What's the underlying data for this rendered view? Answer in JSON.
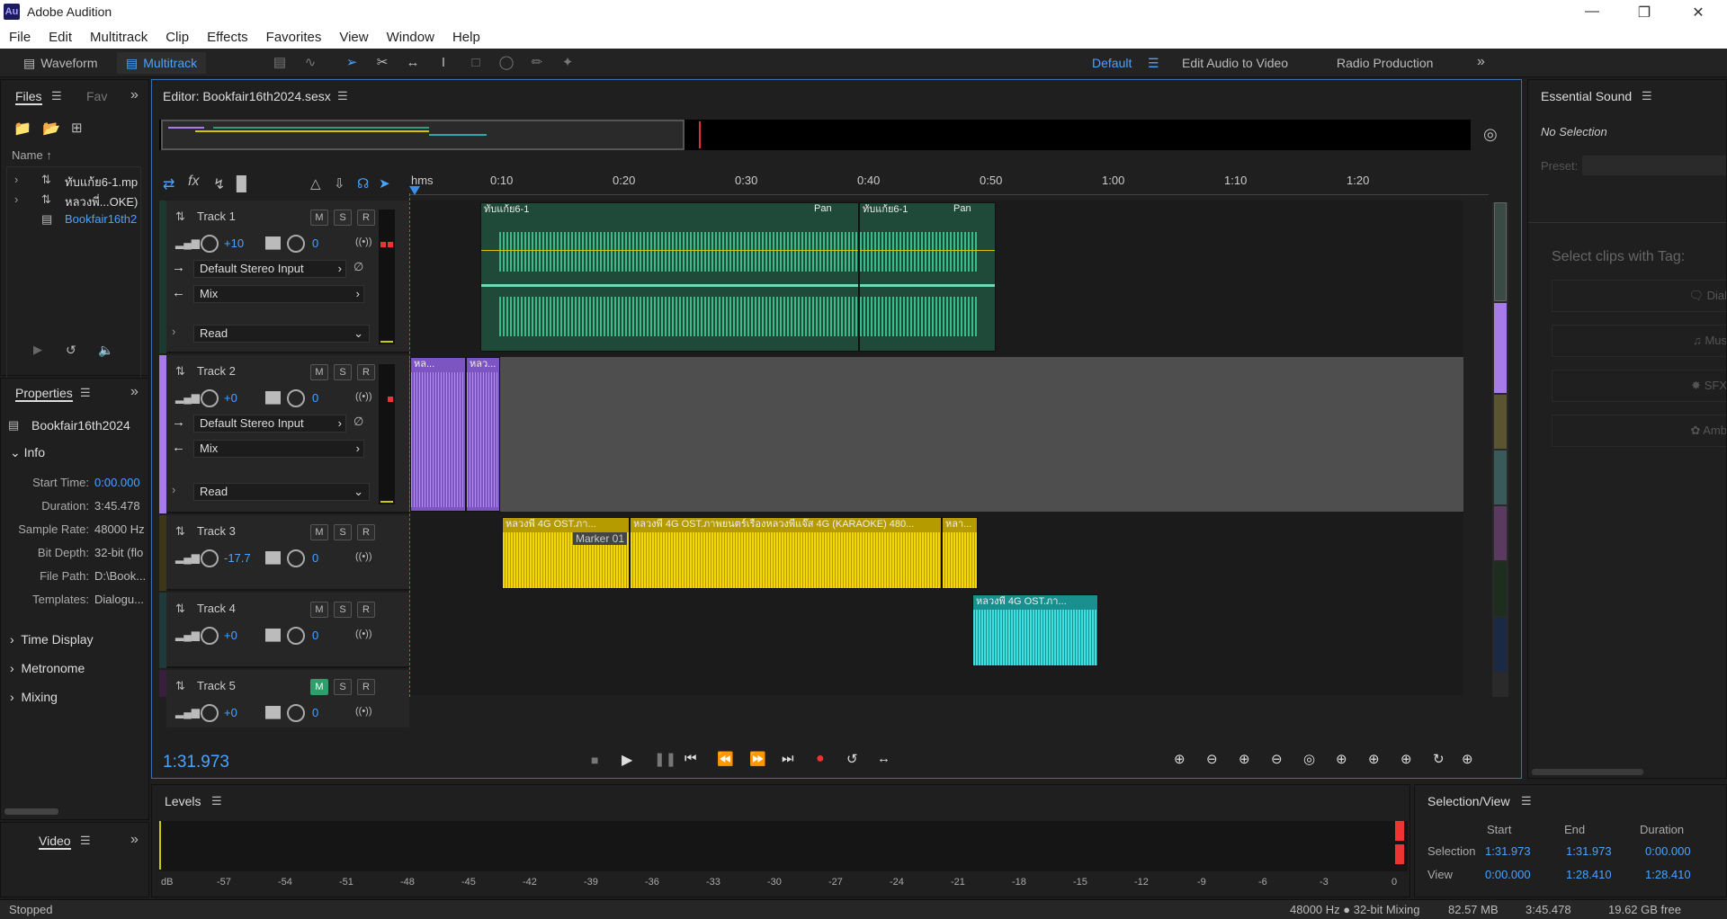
{
  "window": {
    "title": "Adobe Audition",
    "logo_text": "Au"
  },
  "menu": [
    "File",
    "Edit",
    "Multitrack",
    "Clip",
    "Effects",
    "Favorites",
    "View",
    "Window",
    "Help"
  ],
  "toolbar": {
    "waveform_label": "Waveform",
    "multitrack_label": "Multitrack",
    "workspaces": [
      {
        "label": "Default",
        "active": true
      },
      {
        "label": "Edit Audio to Video",
        "active": false
      },
      {
        "label": "Radio Production",
        "active": false
      }
    ]
  },
  "files_panel": {
    "tab_files": "Files",
    "tab_favorites": "Fav",
    "column_name": "Name ↑",
    "items": [
      {
        "name": "ทับแก้ย6-1.mp",
        "type": "audio",
        "selected": false
      },
      {
        "name": "หลวงพี่...OKE)",
        "type": "audio",
        "selected": false
      },
      {
        "name": "Bookfair16th2",
        "type": "session",
        "selected": true
      }
    ]
  },
  "properties_panel": {
    "title": "Properties",
    "session_name": "Bookfair16th2024",
    "info_section": "Info",
    "rows": [
      {
        "key": "Start Time:",
        "value": "0:00.000",
        "highlight": true
      },
      {
        "key": "Duration:",
        "value": "3:45.478",
        "highlight": false
      },
      {
        "key": "Sample Rate:",
        "value": "48000 Hz",
        "highlight": false
      },
      {
        "key": "Bit Depth:",
        "value": "32-bit (flo",
        "highlight": false
      },
      {
        "key": "File Path:",
        "value": "D:\\Book...",
        "highlight": false
      },
      {
        "key": "Templates:",
        "value": "Dialogu...",
        "highlight": false
      }
    ],
    "sections": [
      "Time Display",
      "Metronome",
      "Mixing"
    ]
  },
  "video_panel": {
    "title": "Video"
  },
  "editor": {
    "title": "Editor: Bookfair16th2024.sesx",
    "current_time": "1:31.973",
    "ruler": [
      "hms",
      "0:10",
      "0:20",
      "0:30",
      "0:40",
      "0:50",
      "1:00",
      "1:10",
      "1:20"
    ],
    "tracks": [
      {
        "name": "Track 1",
        "volume": "+10",
        "pan": "0",
        "input": "Default Stereo Input",
        "output": "Mix",
        "automation": "Read",
        "color": "#2e9e7a",
        "mute": false,
        "clips": [
          {
            "title": "ทับแก้ย6-1",
            "pan": "Pan"
          },
          {
            "title": "ทับแก้ย6-1",
            "pan": "Pan"
          }
        ]
      },
      {
        "name": "Track 2",
        "volume": "+0",
        "pan": "0",
        "input": "Default Stereo Input",
        "output": "Mix",
        "automation": "Read",
        "color": "#a87ce8",
        "mute": false,
        "clips": [
          {
            "title": "หล..."
          },
          {
            "title": "หลว..."
          }
        ]
      },
      {
        "name": "Track 3",
        "volume": "-17.7",
        "pan": "0",
        "color": "#7a6e22",
        "mute": false,
        "clips": [
          {
            "title": "หลวงพี่ 4G OST.ภา..."
          },
          {
            "title": "หลวงพี่ 4G OST.ภาพยนตร์เรื่องหลวงพี่แจ๊ส 4G (KARAOKE) 480..."
          },
          {
            "title": "หลา..."
          }
        ],
        "marker": "Marker 01"
      },
      {
        "name": "Track 4",
        "volume": "+0",
        "pan": "0",
        "color": "#2a5e5e",
        "mute": false,
        "clips": [
          {
            "title": "หลวงพี่ 4G OST.ภา..."
          }
        ]
      },
      {
        "name": "Track 5",
        "volume": "+0",
        "pan": "0",
        "color": "#5a2e5e",
        "mute": true,
        "clips": []
      }
    ],
    "msr_labels": [
      "M",
      "S",
      "R"
    ]
  },
  "essential_sound": {
    "title": "Essential Sound",
    "no_selection": "No Selection",
    "preset_label": "Preset:",
    "select_clips": "Select clips with Tag:",
    "tags": [
      "Dial",
      "Mus",
      "SFX",
      "Amb"
    ]
  },
  "levels_panel": {
    "title": "Levels",
    "ticks": [
      "dB",
      "-57",
      "-54",
      "-51",
      "-48",
      "-45",
      "-42",
      "-39",
      "-36",
      "-33",
      "-30",
      "-27",
      "-24",
      "-21",
      "-18",
      "-15",
      "-12",
      "-9",
      "-6",
      "-3",
      "0"
    ]
  },
  "selection_view": {
    "title": "Selection/View",
    "headers": [
      "Start",
      "End",
      "Duration"
    ],
    "rows": [
      {
        "label": "Selection",
        "start": "1:31.973",
        "end": "1:31.973",
        "duration": "0:00.000"
      },
      {
        "label": "View",
        "start": "0:00.000",
        "end": "1:28.410",
        "duration": "1:28.410"
      }
    ]
  },
  "statusbar": {
    "state": "Stopped",
    "format": "48000 Hz ● 32-bit Mixing",
    "memory": "82.57 MB",
    "duration": "3:45.478",
    "disk": "19.62 GB free"
  }
}
